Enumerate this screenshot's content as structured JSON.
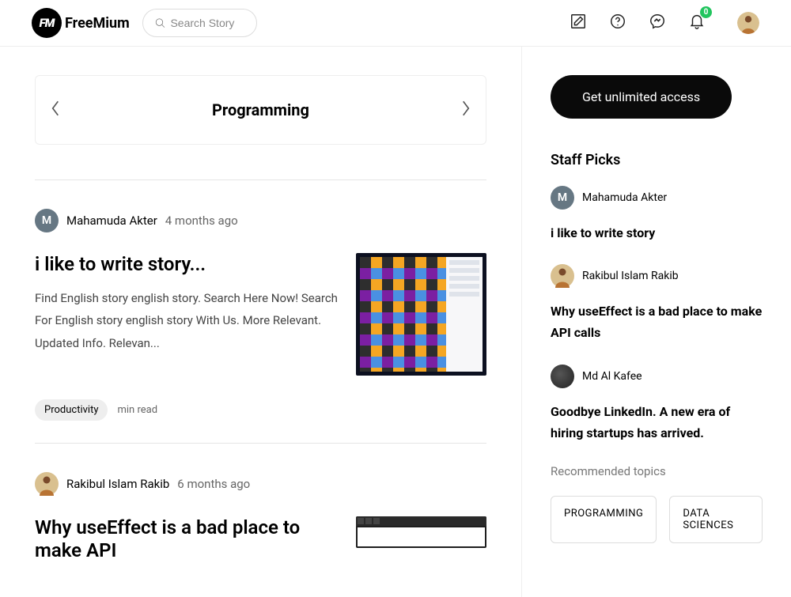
{
  "brand": {
    "initials": "FM",
    "name": "FreeMium"
  },
  "search": {
    "placeholder": "Search Story"
  },
  "notifications": {
    "count": "0"
  },
  "category": {
    "label": "Programming"
  },
  "stories": [
    {
      "author": "Mahamuda Akter",
      "initial": "M",
      "avatar_bg": "#667783",
      "time": "4 months ago",
      "title": "i like to write story...",
      "desc": "Find English story english story. Search Here Now! Search For English story english story With Us. More Relevant. Updated Info. Relevan...",
      "tag": "Productivity",
      "read": "min read"
    },
    {
      "author": "Rakibul Islam Rakib",
      "time": "6 months ago",
      "title": "Why useEffect is a bad place to make API"
    }
  ],
  "cta": "Get unlimited access",
  "staff_label": "Staff Picks",
  "picks": [
    {
      "name": "Mahamuda Akter",
      "initial": "M",
      "avatar_bg": "#667783",
      "title": "i like to write story"
    },
    {
      "name": "Rakibul Islam Rakib",
      "title": "Why useEffect is a bad place to make API calls"
    },
    {
      "name": "Md Al Kafee",
      "avatar_bg": "#3a3a3a",
      "title": "Goodbye LinkedIn. A new era of hiring startups has arrived."
    }
  ],
  "topics_label": "Recommended topics",
  "topics": [
    "PROGRAMMING",
    "DATA SCIENCES"
  ]
}
